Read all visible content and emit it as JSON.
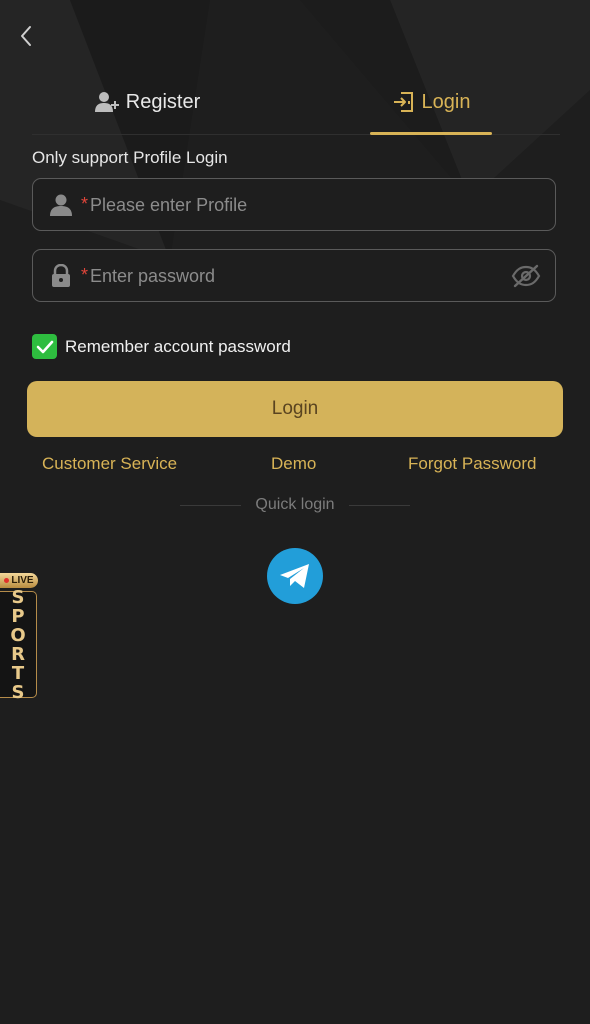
{
  "tabs": {
    "register_label": "Register",
    "login_label": "Login",
    "active": "Login"
  },
  "form": {
    "hint": "Only support Profile Login",
    "required_marker": "*",
    "profile_placeholder": "Please enter Profile",
    "password_placeholder": "Enter password",
    "remember_label": "Remember account password",
    "remember_checked": true,
    "login_button": "Login"
  },
  "links": {
    "customer_service": "Customer Service",
    "demo": "Demo",
    "forgot_password": "Forgot Password"
  },
  "quick_login": {
    "label": "Quick login",
    "providers": [
      "telegram-icon"
    ]
  },
  "sports_widget": {
    "badge": "LIVE",
    "letters": [
      "S",
      "P",
      "O",
      "R",
      "T",
      "S"
    ]
  },
  "colors": {
    "background": "#1e1e1e",
    "accent_gold": "#d8b356",
    "button_gold": "#d4b35a",
    "required_red": "#e0453a",
    "checkbox_green": "#2ebd3f",
    "telegram_blue": "#229ed9"
  },
  "icons": {
    "back": "chevron-left-icon",
    "register": "user-plus-icon",
    "login": "door-enter-icon",
    "profile": "user-icon",
    "password": "lock-icon",
    "visibility": "eye-off-icon",
    "check": "check-icon"
  }
}
